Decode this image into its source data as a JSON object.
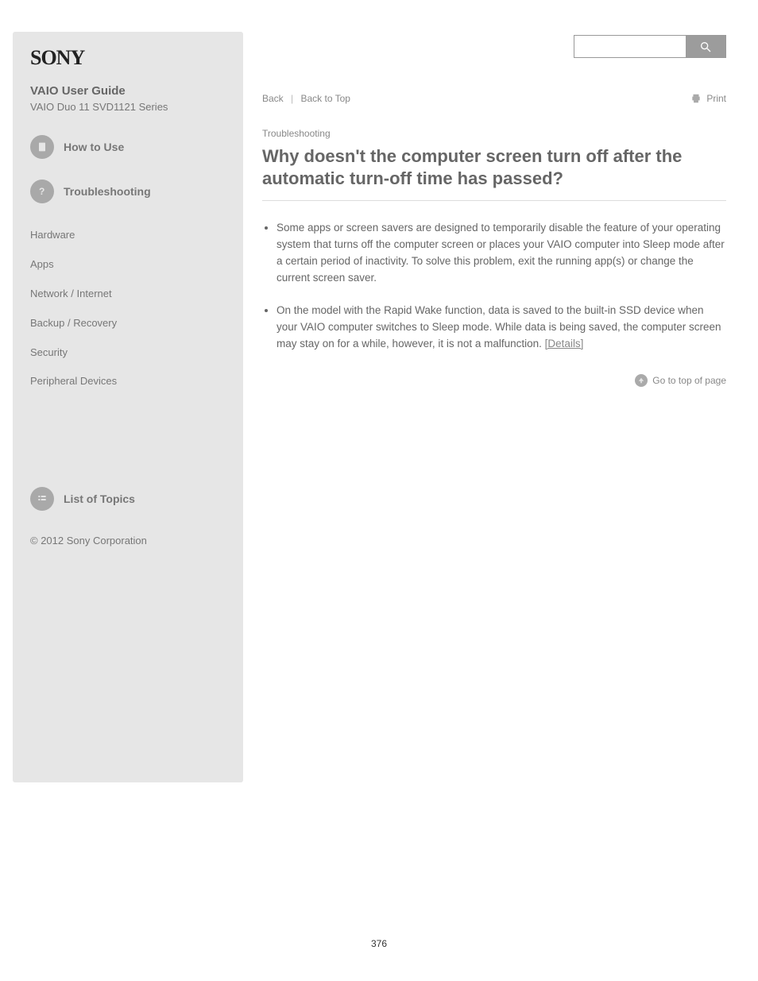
{
  "logo": "SONY",
  "product": {
    "title": "VAIO User Guide",
    "series": "VAIO Duo 11 SVD1121 Series"
  },
  "sidebar": {
    "howto": {
      "label": "How to Use"
    },
    "trouble": {
      "label": "Troubleshooting"
    },
    "group": [
      "Hardware",
      "Apps",
      "Network / Internet",
      "Backup / Recovery",
      "Security",
      "Peripheral Devices"
    ],
    "list_nav": {
      "label": "List of Topics"
    },
    "copyright": "© 2012 Sony Corporation"
  },
  "search": {
    "placeholder": ""
  },
  "breadcrumb": {
    "back": "Back",
    "top": "Back to Top"
  },
  "print": "Print",
  "topic": "Troubleshooting",
  "title": "Why doesn't the computer screen turn off after the automatic turn-off time has passed?",
  "bullets": [
    {
      "text": "Some apps or screen savers are designed to temporarily disable the feature of your operating system that turns off the computer screen or places your VAIO computer into Sleep mode after a certain period of inactivity. To solve this problem, exit the running app(s) or change the current screen saver."
    },
    {
      "prefix": "On the model with the Rapid Wake function, data is saved to the built-in SSD device when your VAIO computer switches to Sleep mode. While data is being saved, the computer screen may stay on for a while, however, it is not a malfunction. ",
      "link": "[Details]"
    }
  ],
  "gototop": "Go to top of page",
  "pagenum": "376"
}
